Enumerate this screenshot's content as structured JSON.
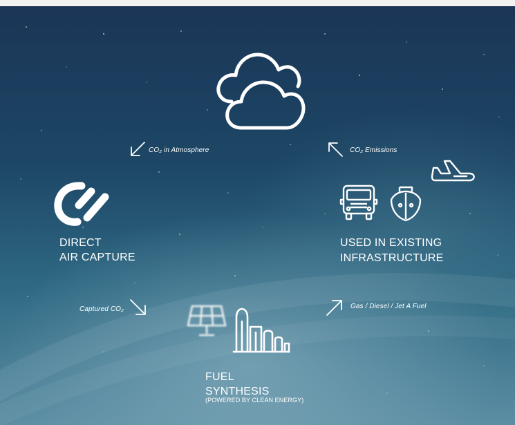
{
  "diagram": {
    "arrows": {
      "co2_in_atmosphere": "CO₂ in Atmosphere",
      "co2_emissions": "CO₂ Emissions",
      "captured_co2": "Captured CO₂",
      "fuels": "Gas / Diesel / Jet A Fuel"
    },
    "nodes": {
      "direct_air_capture": {
        "line1": "DIRECT",
        "line2": "AIR CAPTURE"
      },
      "existing_infrastructure": {
        "line1": "USED IN EXISTING",
        "line2": "INFRASTRUCTURE"
      },
      "fuel_synthesis": {
        "line1": "FUEL",
        "line2": "SYNTHESIS",
        "note": "(POWERED BY CLEAN ENERGY)"
      }
    },
    "icons": [
      "cloud-icon",
      "direct-air-capture-logo",
      "airplane-icon",
      "truck-icon",
      "ship-icon",
      "solar-panel-icon",
      "refinery-icon",
      "arrow-down-left-icon",
      "arrow-up-left-icon",
      "arrow-down-right-icon",
      "arrow-up-right-icon"
    ],
    "colors": {
      "sky_top": "#1b3556",
      "sky_bottom": "#5c8ea3",
      "foreground": "#ffffff"
    }
  }
}
